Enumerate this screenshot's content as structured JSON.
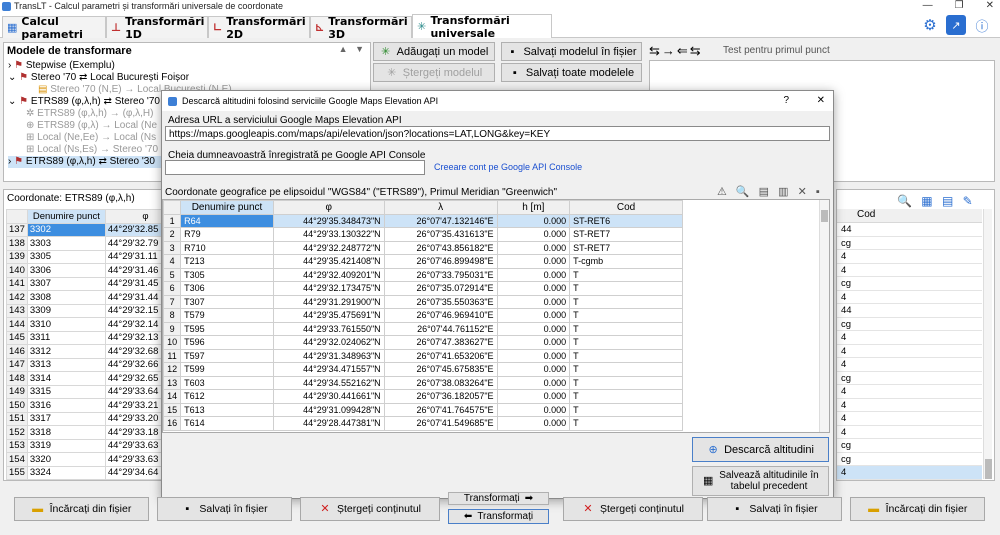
{
  "window": {
    "title": "TransLT - Calcul parametri și transformări universale de coordonate",
    "controls": [
      "—",
      "❐",
      "✕"
    ]
  },
  "tabs": [
    {
      "label": "Calcul parametri",
      "active": false
    },
    {
      "label": "Transformări 1D",
      "active": false
    },
    {
      "label": "Transformări 2D",
      "active": false
    },
    {
      "label": "Transformări 3D",
      "active": false
    },
    {
      "label": "Transformări universale",
      "active": true
    }
  ],
  "models": {
    "header": "Modele de transformare",
    "tree": [
      {
        "text": "Stepwise (Exemplu)",
        "grey": false
      },
      {
        "text": "Stereo '70 ⇄ Local București Foișor",
        "grey": false
      },
      {
        "text": "Stereo '70 (N,E) → Local București (N,E)",
        "grey": true
      },
      {
        "text": "ETRS89 (φ,λ,h) ⇄ Stereo '70",
        "grey": false
      },
      {
        "text": "ETRS89 (φ,λ,h) → (φ,λ,H)",
        "grey": true
      },
      {
        "text": "ETRS89 (φ,λ) → Local (Ne",
        "grey": true
      },
      {
        "text": "Local (Ne,Ee) → Local (Ns",
        "grey": true
      },
      {
        "text": "Local (Ns,Es) → Stereo '70",
        "grey": true
      },
      {
        "text": "ETRS89 (φ,λ,h) ⇄ Stereo '30",
        "grey": false
      }
    ]
  },
  "model_buttons": {
    "add": "Adăugați un model",
    "delete": "Ștergeți modelul",
    "save_model": "Salvați modelul în fișier",
    "save_all": "Salvați toate modelele"
  },
  "test_label": "Test pentru primul punct",
  "left_grid": {
    "title": "Coordonate: ETRS89 (φ,λ,h)",
    "columns": [
      "Denumire punct",
      "φ"
    ],
    "rows": [
      [
        "137",
        "3302",
        "44°29'32.85"
      ],
      [
        "138",
        "3303",
        "44°29'32.79"
      ],
      [
        "139",
        "3305",
        "44°29'31.11"
      ],
      [
        "140",
        "3306",
        "44°29'31.46"
      ],
      [
        "141",
        "3307",
        "44°29'31.45"
      ],
      [
        "142",
        "3308",
        "44°29'31.44"
      ],
      [
        "143",
        "3309",
        "44°29'32.15"
      ],
      [
        "144",
        "3310",
        "44°29'32.14"
      ],
      [
        "145",
        "3311",
        "44°29'32.13"
      ],
      [
        "146",
        "3312",
        "44°29'32.68"
      ],
      [
        "147",
        "3313",
        "44°29'32.66"
      ],
      [
        "148",
        "3314",
        "44°29'32.65"
      ],
      [
        "149",
        "3315",
        "44°29'33.64"
      ],
      [
        "150",
        "3316",
        "44°29'33.21"
      ],
      [
        "151",
        "3317",
        "44°29'33.20"
      ],
      [
        "152",
        "3318",
        "44°29'33.18"
      ],
      [
        "153",
        "3319",
        "44°29'33.63"
      ],
      [
        "154",
        "3320",
        "44°29'33.63"
      ],
      [
        "155",
        "3324",
        "44°29'34.64"
      ]
    ]
  },
  "right_grid": {
    "column": "Cod",
    "values": [
      "44",
      "cg",
      "4",
      "4",
      "cg",
      "4",
      "44",
      "cg",
      "4",
      "4",
      "4",
      "cg",
      "4",
      "4",
      "4",
      "4",
      "cg",
      "cg",
      "4"
    ]
  },
  "dialog": {
    "title": "Descarcă altitudini folosind serviciile Google Maps Elevation API",
    "help": "?",
    "close": "✕",
    "url_label": "Adresa URL a serviciului Google Maps Elevation API",
    "url_value": "https://maps.googleapis.com/maps/api/elevation/json?locations=LAT,LONG&key=KEY",
    "key_label": "Cheia dumneavoastră înregistrată pe Google API Console",
    "key_value": "",
    "create_account": "Creeare cont pe Google API Console",
    "coords_label": "Coordonate geografice pe elipsoidul \"WGS84\" (\"ETRS89\"), Primul Meridian \"Greenwich\"",
    "columns": [
      "Denumire punct",
      "φ",
      "λ",
      "h [m]",
      "Cod"
    ],
    "rows": [
      [
        "1",
        "R64",
        "44°29'35.348473\"N",
        "26°07'47.132146\"E",
        "0.000",
        "ST-RET6"
      ],
      [
        "2",
        "R79",
        "44°29'33.130322\"N",
        "26°07'35.431613\"E",
        "0.000",
        "ST-RET7"
      ],
      [
        "3",
        "R710",
        "44°29'32.248772\"N",
        "26°07'43.856182\"E",
        "0.000",
        "ST-RET7"
      ],
      [
        "4",
        "T213",
        "44°29'35.421408\"N",
        "26°07'46.899498\"E",
        "0.000",
        "T-cgmb"
      ],
      [
        "5",
        "T305",
        "44°29'32.409201\"N",
        "26°07'33.795031\"E",
        "0.000",
        "T"
      ],
      [
        "6",
        "T306",
        "44°29'32.173475\"N",
        "26°07'35.072914\"E",
        "0.000",
        "T"
      ],
      [
        "7",
        "T307",
        "44°29'31.291900\"N",
        "26°07'35.550363\"E",
        "0.000",
        "T"
      ],
      [
        "8",
        "T579",
        "44°29'35.475691\"N",
        "26°07'46.969410\"E",
        "0.000",
        "T"
      ],
      [
        "9",
        "T595",
        "44°29'33.761550\"N",
        "26°07'44.761152\"E",
        "0.000",
        "T"
      ],
      [
        "10",
        "T596",
        "44°29'32.024062\"N",
        "26°07'47.383627\"E",
        "0.000",
        "T"
      ],
      [
        "11",
        "T597",
        "44°29'31.348963\"N",
        "26°07'41.653206\"E",
        "0.000",
        "T"
      ],
      [
        "12",
        "T599",
        "44°29'34.471557\"N",
        "26°07'45.675835\"E",
        "0.000",
        "T"
      ],
      [
        "13",
        "T603",
        "44°29'34.552162\"N",
        "26°07'38.083264\"E",
        "0.000",
        "T"
      ],
      [
        "14",
        "T612",
        "44°29'30.441661\"N",
        "26°07'36.182057\"E",
        "0.000",
        "T"
      ],
      [
        "15",
        "T613",
        "44°29'31.099428\"N",
        "26°07'41.764575\"E",
        "0.000",
        "T"
      ],
      [
        "16",
        "T614",
        "44°29'28.447381\"N",
        "26°07'41.549685\"E",
        "0.000",
        "T"
      ]
    ],
    "download_button": "Descarcă altitudini",
    "save_button_line1": "Salvează altitudinile în",
    "save_button_line2": "tabelul precedent"
  },
  "bottom": {
    "load_left": "Încărcați din fișier",
    "save_left": "Salvați în fișier",
    "clear_left": "Ștergeți conținutul",
    "transform_right": "Transformați",
    "transform_left": "Transformați",
    "clear_right": "Ștergeți conținutul",
    "save_right": "Salvați în fișier",
    "load_right": "Încărcați din fișier"
  }
}
